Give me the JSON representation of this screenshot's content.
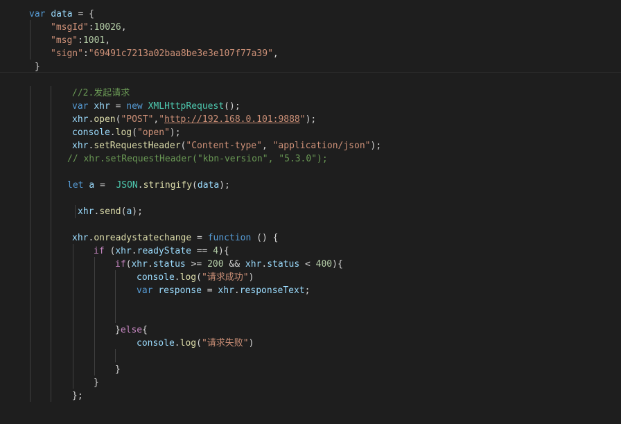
{
  "editor": {
    "language": "javascript",
    "theme": "dark",
    "background": "#1e1e1e",
    "tokens": {
      "l1": {
        "kw": "var",
        "name": "data",
        "op": " = {"
      },
      "l2": {
        "key": "\"msgId\"",
        "sep": ":",
        "val": "10026",
        "tail": ","
      },
      "l3": {
        "key": "\"msg\"",
        "sep": ":",
        "val": "1001",
        "tail": ","
      },
      "l4": {
        "key": "\"sign\"",
        "sep": ":",
        "val": "\"69491c7213a02baa8be3e3e107f77a39\"",
        "tail": ","
      },
      "l5": {
        "close": "}"
      },
      "l6": {
        "comment": "//2.发起请求"
      },
      "l7": {
        "kw": "var",
        "name": "xhr",
        "op1": " = ",
        "kw2": "new",
        "cls": "XMLHttpRequest",
        "tail": "();"
      },
      "l8": {
        "obj": "xhr",
        "dot": ".",
        "fn": "open",
        "p1": "(",
        "s1": "\"POST\"",
        "comma": ",",
        "s2q1": "\"",
        "url": "http://192.168.0.101:9888",
        "s2q2": "\"",
        "tail": ");"
      },
      "l9": {
        "obj": "console",
        "dot": ".",
        "fn": "log",
        "p1": "(",
        "s1": "\"open\"",
        "tail": ");"
      },
      "l10": {
        "obj": "xhr",
        "dot": ".",
        "fn": "setRequestHeader",
        "p1": "(",
        "s1": "\"Content-type\"",
        "comma": ", ",
        "s2": "\"application/json\"",
        "tail": ");"
      },
      "l11": {
        "comment": "// xhr.setRequestHeader(\"kbn-version\", \"5.3.0\");"
      },
      "l12": {
        "kw": "let",
        "name": "a",
        "op": " =  ",
        "obj": "JSON",
        "dot": ".",
        "fn": "stringify",
        "p1": "(",
        "arg": "data",
        "tail": ");"
      },
      "l13": {
        "obj": "xhr",
        "dot": ".",
        "fn": "send",
        "p1": "(",
        "arg": "a",
        "tail": ");"
      },
      "l14": {
        "obj": "xhr",
        "dot": ".",
        "prop": "onreadystatechange",
        "op": " = ",
        "kw": "function",
        "tail": " () {"
      },
      "l15": {
        "kw": "if",
        "p1": " (",
        "obj": "xhr",
        "dot": ".",
        "prop": "readyState",
        "op": " == ",
        "num": "4",
        "tail": "){"
      },
      "l16": {
        "kw": "if",
        "p1": "(",
        "obj": "xhr",
        "dot": ".",
        "prop": "status",
        "op": " >= ",
        "num": "200",
        "and": " && ",
        "obj2": "xhr",
        "dot2": ".",
        "prop2": "status",
        "op2": " < ",
        "num2": "400",
        "tail": "){"
      },
      "l17": {
        "obj": "console",
        "dot": ".",
        "fn": "log",
        "p1": "(",
        "s1": "\"请求成功\"",
        "tail": ")"
      },
      "l18": {
        "kw": "var",
        "name": "response",
        "op": " = ",
        "obj": "xhr",
        "dot": ".",
        "prop": "responseText",
        "tail": ";"
      },
      "l19": {
        "brace": "}",
        "kw": "else",
        "tail": "{"
      },
      "l20": {
        "obj": "console",
        "dot": ".",
        "fn": "log",
        "p1": "(",
        "s1": "\"请求失败\"",
        "tail": ")"
      },
      "l21": {
        "close": "}"
      },
      "l22": {
        "close": "}"
      },
      "l23": {
        "close": "};"
      }
    }
  }
}
